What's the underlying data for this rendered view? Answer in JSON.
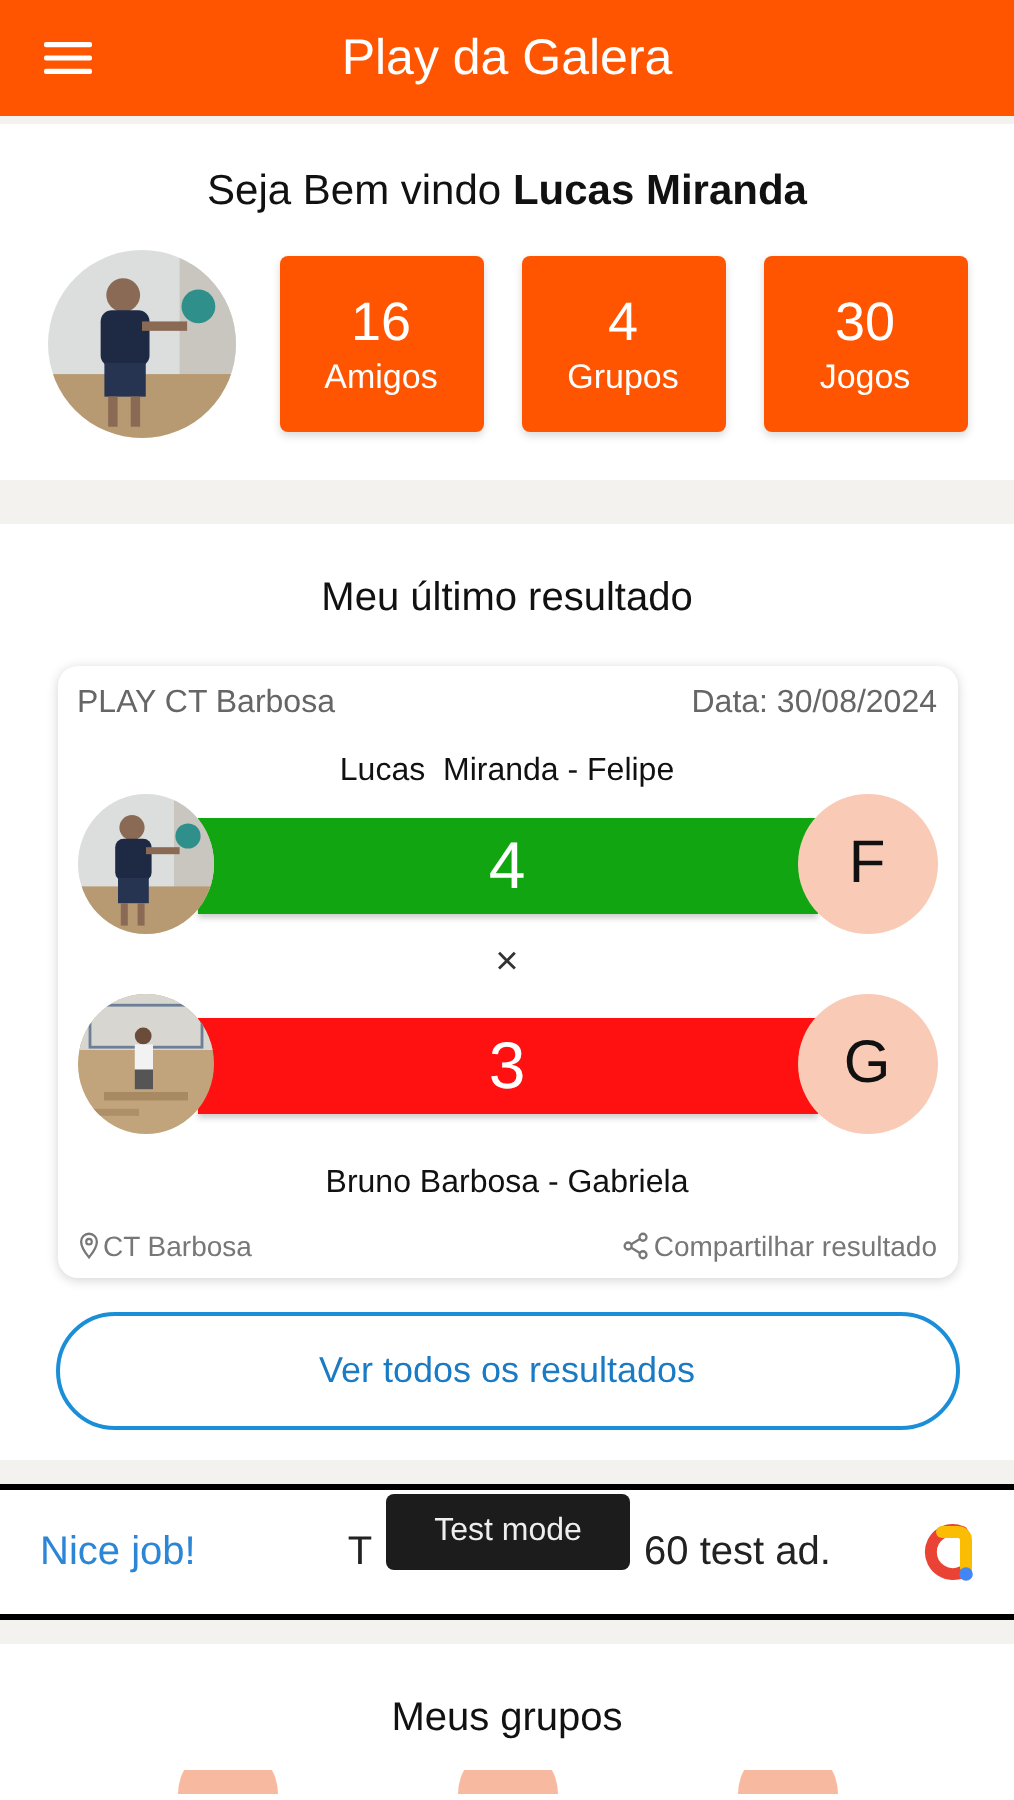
{
  "app_bar": {
    "title": "Play da Galera"
  },
  "profile": {
    "welcome": "Seja Bem vindo **Lucas Miranda**",
    "stats": [
      {
        "value": "16",
        "label": "Amigos"
      },
      {
        "value": "4",
        "label": "Grupos"
      },
      {
        "value": "30",
        "label": "Jogos"
      }
    ]
  },
  "last_result": {
    "heading": "Meu último resultado",
    "venue": "PLAY CT Barbosa",
    "date": "Data: 30/08/2024",
    "teams": [
      {
        "players": "Lucas  Miranda - Felipe",
        "score": "4",
        "initial": "F",
        "color": "#11a611"
      },
      {
        "players": "Bruno Barbosa - Gabriela",
        "score": "3",
        "initial": "G",
        "color": "#ff1111"
      }
    ],
    "versus": "×",
    "location": "CT Barbosa",
    "share": "Compartilhar resultado",
    "view_all": "Ver todos os resultados"
  },
  "ad_banner": {
    "headline": "Nice job!",
    "text_start": "T",
    "text_end": "60 test ad.",
    "badge": "Test mode"
  },
  "groups": {
    "heading": "Meus grupos"
  }
}
